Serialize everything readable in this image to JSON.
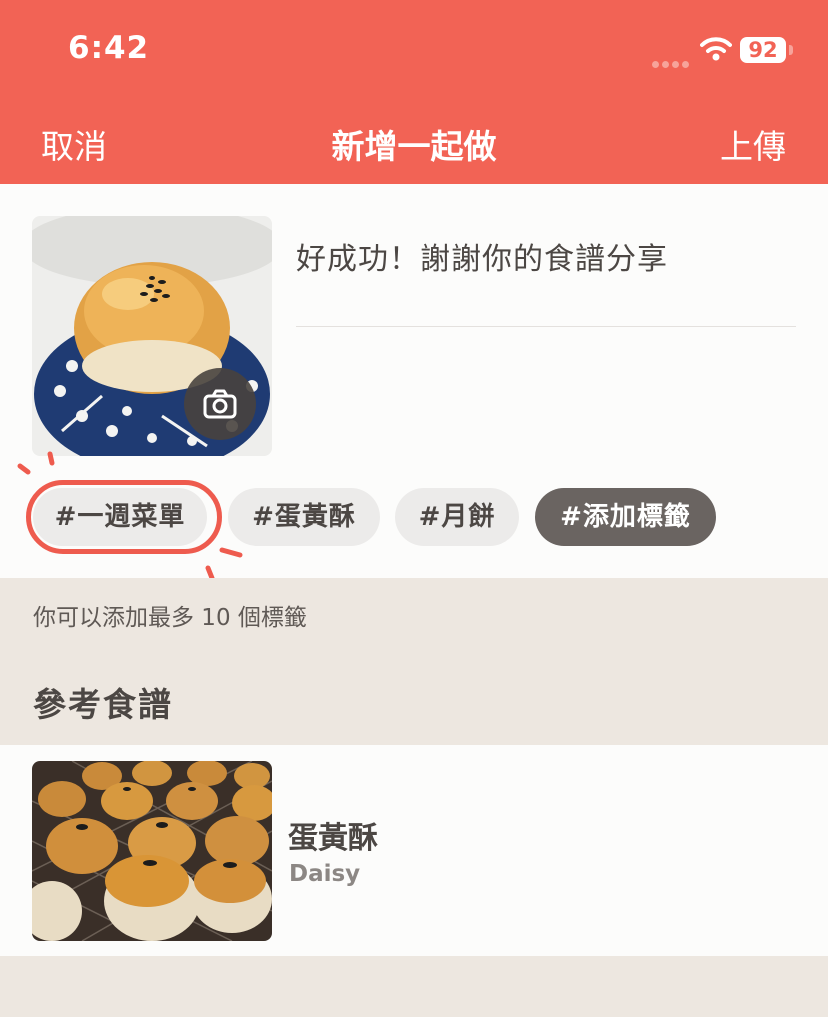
{
  "status_bar": {
    "time": "6:42",
    "battery": "92"
  },
  "nav": {
    "cancel": "取消",
    "title": "新增一起做",
    "upload": "上傳"
  },
  "compose": {
    "caption": "好成功！謝謝你的食譜分享"
  },
  "tags": [
    "#一週菜單",
    "#蛋黃酥",
    "#月餅"
  ],
  "add_tag_label": "#添加標籤",
  "hint": "你可以添加最多 10 個標籤",
  "reference": {
    "section_title": "參考食譜",
    "recipe_title": "蛋黃酥",
    "author": "Daisy"
  },
  "colors": {
    "brand": "#f26355",
    "highlight_ring": "#ee5b4e",
    "add_tag_bg": "#6a6461"
  }
}
